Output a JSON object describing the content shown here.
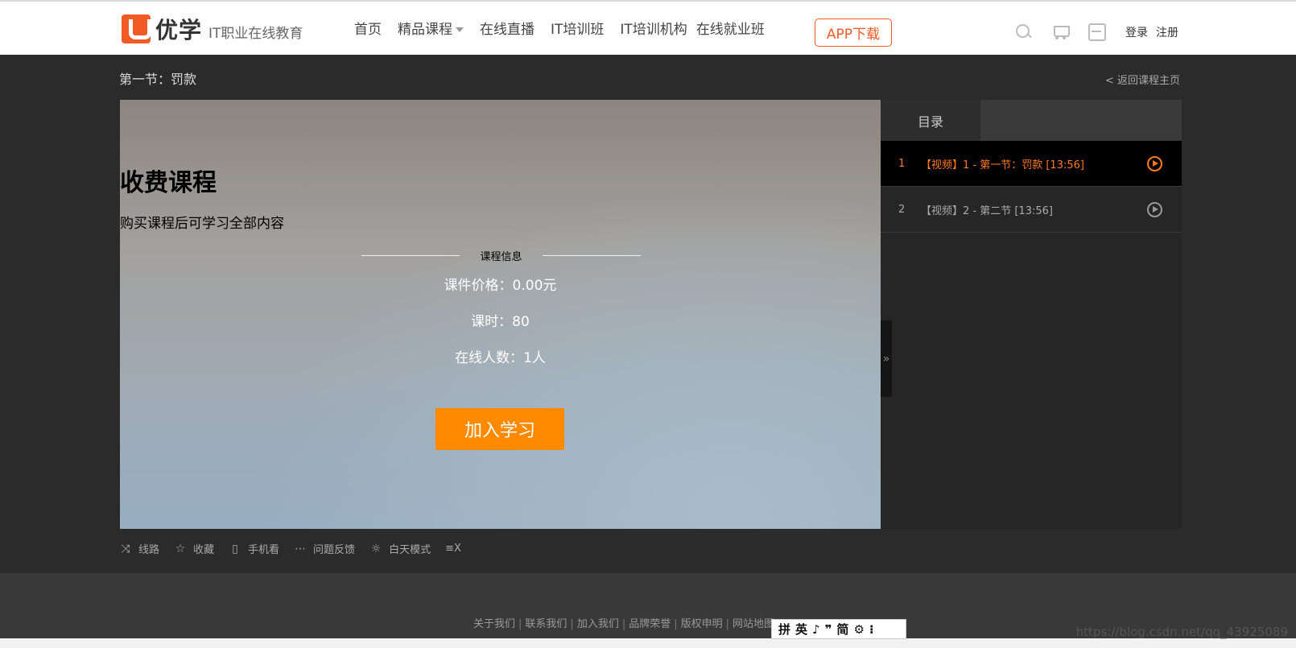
{
  "header": {
    "logo_name": "优学",
    "logo_slogan": "IT职业在线教育",
    "nav": [
      "首页",
      "精品课程",
      "在线直播",
      "IT培训班",
      "IT培训机构",
      "在线就业班"
    ],
    "app_button": "APP下载",
    "login": "登录",
    "register": "注册"
  },
  "page": {
    "section_title": "第一节：罚款",
    "back_link": "< 返回课程主页"
  },
  "player": {
    "title": "收费课程",
    "subtitle": "购买课程后可学习全部内容",
    "info_label": "课程信息",
    "price": "课件价格：0.00元",
    "hours": "课时：80",
    "online": "在线人数：1人",
    "join_button": "加入学习",
    "toggle": "»"
  },
  "sidebar": {
    "tab": "目录",
    "lessons": [
      {
        "num": "1",
        "title": "【视频】1 - 第一节：罚款 [13:56]"
      },
      {
        "num": "2",
        "title": "【视频】2 - 第二节 [13:56]"
      }
    ]
  },
  "toolbar": {
    "route": "线路",
    "favorite": "收藏",
    "mobile": "手机看",
    "feedback": "问题反馈",
    "day_mode": "白天模式",
    "extra": "≡X"
  },
  "footer": {
    "links": [
      "关于我们",
      "联系我们",
      "加入我们",
      "品牌荣誉",
      "版权申明",
      "网站地图"
    ],
    "watermark": "https://blog.csdn.net/qq_43925089",
    "ime": [
      "拼",
      "英",
      "♪",
      "❞",
      "简",
      "⚙",
      "⁝"
    ]
  },
  "colors": {
    "accent": "#f15a24",
    "join": "#ff8a00",
    "active_lesson": "#ff7a1a"
  }
}
